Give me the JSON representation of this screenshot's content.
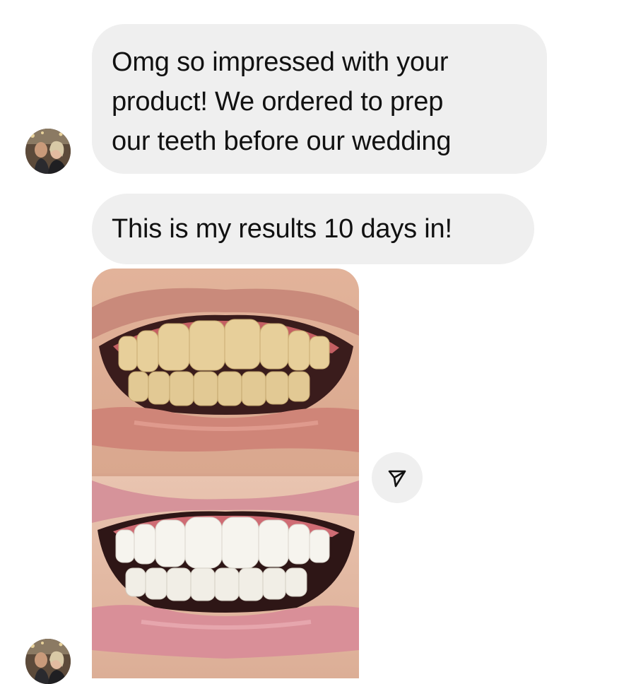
{
  "messages": [
    {
      "lines": [
        "Omg so impressed with your",
        "product! We ordered to prep",
        "our teeth before our wedding"
      ]
    },
    {
      "lines": [
        "This is my results 10 days in!"
      ]
    }
  ],
  "icons": {
    "avatar": "profile-photo",
    "share": "send-icon"
  },
  "colors": {
    "bubble": "#efefef",
    "text": "#111111",
    "background": "#ffffff"
  }
}
